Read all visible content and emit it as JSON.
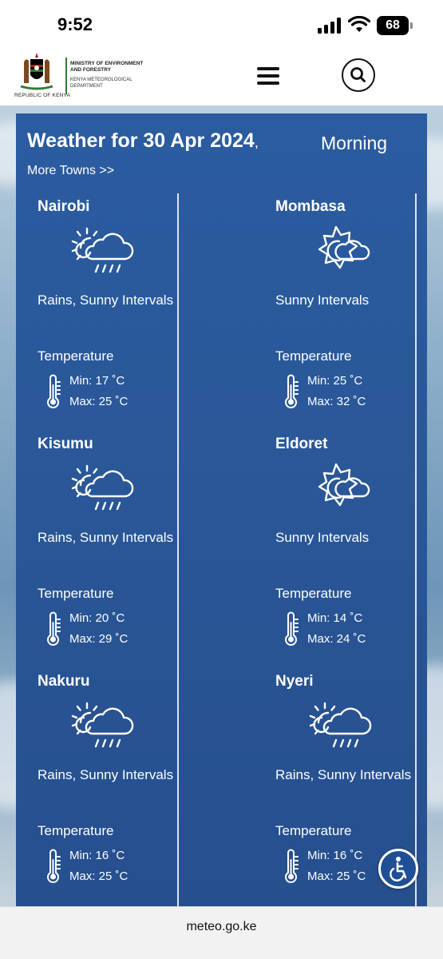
{
  "status_bar": {
    "time": "9:52",
    "battery": "68"
  },
  "header": {
    "republic": "REPUBLIC OF KENYA",
    "ministry": "MINISTRY OF ENVIRONMENT AND FORESTRY",
    "department": "KENYA METEOROLOGICAL DEPARTMENT"
  },
  "weather": {
    "title": "Weather for 30 Apr 2024",
    "separator": ",",
    "period": "Morning",
    "more_towns": "More Towns >>",
    "temperature_label": "Temperature",
    "towns": [
      {
        "name": "Nairobi",
        "icon": "rain-sun-cloud-icon",
        "condition": "Rains, Sunny Intervals",
        "min": "Min: 17 ˚C",
        "max": "Max: 25 ˚C"
      },
      {
        "name": "Mombasa",
        "icon": "sun-cloud-icon",
        "condition": "Sunny Intervals",
        "min": "Min: 25 ˚C",
        "max": "Max: 32 ˚C"
      },
      {
        "name": "Kisumu",
        "icon": "rain-sun-cloud-icon",
        "condition": "Rains, Sunny Intervals",
        "min": "Min: 20 ˚C",
        "max": "Max: 29 ˚C"
      },
      {
        "name": "Eldoret",
        "icon": "sun-cloud-icon",
        "condition": "Sunny Intervals",
        "min": "Min: 14 ˚C",
        "max": "Max: 24 ˚C"
      },
      {
        "name": "Nakuru",
        "icon": "rain-sun-cloud-icon",
        "condition": "Rains, Sunny Intervals",
        "min": "Min: 16 ˚C",
        "max": "Max: 25 ˚C"
      },
      {
        "name": "Nyeri",
        "icon": "rain-sun-cloud-icon",
        "condition": "Rains, Sunny Intervals",
        "min": "Min: 16 ˚C",
        "max": "Max: 25 ˚C"
      }
    ]
  },
  "url_bar": {
    "url": "meteo.go.ke"
  },
  "colors": {
    "panel": "#2a5899",
    "text": "#ffffff",
    "ministry_accent": "#2e7d32"
  }
}
